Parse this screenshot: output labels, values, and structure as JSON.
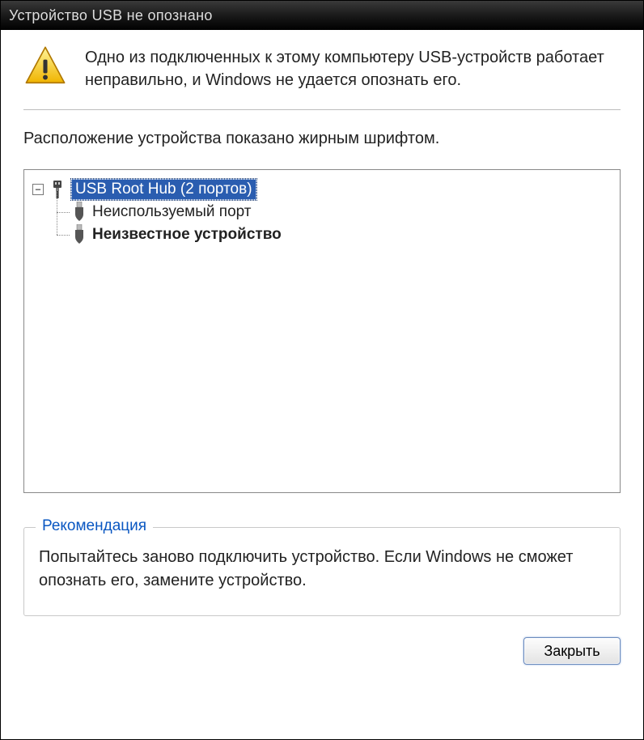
{
  "window": {
    "title": "Устройство USB не опознано"
  },
  "header": {
    "message": "Одно из подключенных к этому компьютеру USB-устройств работает неправильно, и Windows не удается опознать его."
  },
  "location_label": "Расположение устройства показано жирным шрифтом.",
  "tree": {
    "root": {
      "label": "USB Root Hub (2 портов)",
      "expander": "−",
      "selected": true
    },
    "children": [
      {
        "label": "Неиспользуемый порт",
        "bold": false
      },
      {
        "label": "Неизвестное устройство",
        "bold": true
      }
    ]
  },
  "recommendation": {
    "title": "Рекомендация",
    "text": "Попытайтесь заново подключить устройство. Если Windows не сможет опознать его, замените устройство."
  },
  "buttons": {
    "close": "Закрыть"
  }
}
